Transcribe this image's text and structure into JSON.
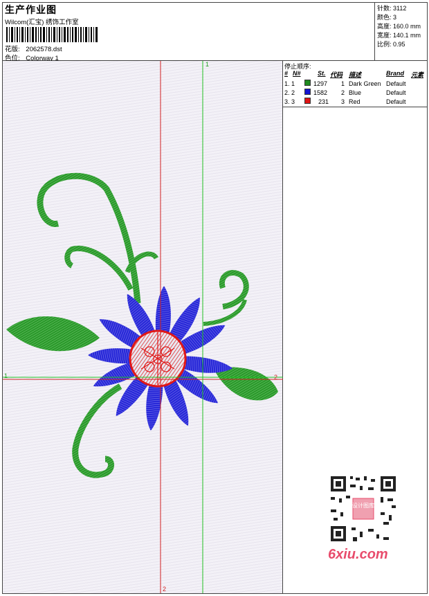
{
  "header": {
    "title": "生产作业图",
    "company": "Wilcom(汇宝) 绣饰工作室",
    "design_label": "花版:",
    "design_value": "2062578.dst",
    "colorway_label": "色位:",
    "colorway_value": "Colorway 1"
  },
  "stats": [
    {
      "label": "针数:",
      "value": "3112"
    },
    {
      "label": "颜色:",
      "value": "3"
    },
    {
      "label": "高度:",
      "value": "160.0 mm"
    },
    {
      "label": "宽度:",
      "value": "140.1 mm"
    },
    {
      "label": "比例:",
      "value": "0.95"
    }
  ],
  "legend": {
    "title": "停止顺序:",
    "headers": [
      "#",
      "N#",
      "St.",
      "代码",
      "描述",
      "Brand",
      "元素"
    ],
    "rows": [
      {
        "idx": "1. 1",
        "color": "#1e8a1e",
        "stitches": "1297",
        "code": "1",
        "desc": "Dark Green",
        "brand": "Default"
      },
      {
        "idx": "2. 2",
        "color": "#1414d2",
        "stitches": "1582",
        "code": "2",
        "desc": "Blue",
        "brand": "Default"
      },
      {
        "idx": "3. 3",
        "color": "#e01414",
        "stitches": "231",
        "code": "3",
        "desc": "Red",
        "brand": "Default"
      }
    ]
  },
  "axes": {
    "h_left": "1",
    "h_right": "2",
    "v_top": "1",
    "v_bottom": "2"
  },
  "colors": {
    "green": "#2a9a2a",
    "blue": "#2828d8",
    "red": "#e01818",
    "axis_red": "#d02020",
    "axis_green": "#20c020"
  },
  "watermark": "6xiu.com",
  "qr_stamp": "设计图库"
}
